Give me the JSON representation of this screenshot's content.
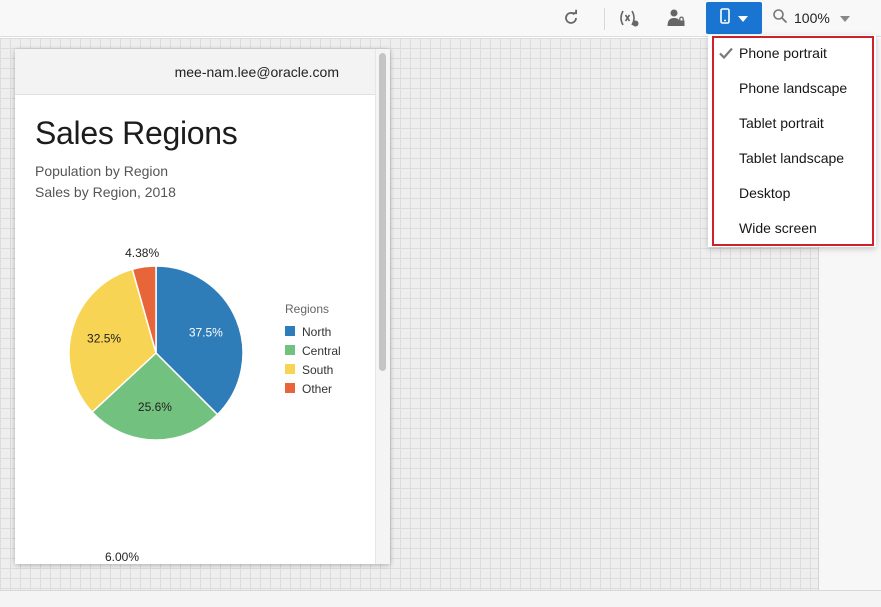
{
  "toolbar": {
    "refresh_icon": "refresh-icon",
    "variables_icon": "variables-icon",
    "person_icon": "person-lock-icon",
    "device_icon": "phone-icon",
    "device_caret_icon": "caret-down-icon",
    "zoom_icon": "magnifier-icon",
    "zoom_value": "100%",
    "zoom_caret_icon": "caret-down-icon",
    "accent_color": "#1a74d1"
  },
  "device_menu": {
    "highlight_color": "#d0202a",
    "items": [
      {
        "label": "Phone portrait",
        "checked": true
      },
      {
        "label": "Phone landscape",
        "checked": false
      },
      {
        "label": "Tablet portrait",
        "checked": false
      },
      {
        "label": "Tablet landscape",
        "checked": false
      },
      {
        "label": "Desktop",
        "checked": false
      },
      {
        "label": "Wide screen",
        "checked": false
      }
    ]
  },
  "phone": {
    "user_email": "mee-nam.lee@oracle.com",
    "page_title": "Sales Regions",
    "subtitle_1": "Population by Region",
    "subtitle_2": "Sales by Region, 2018"
  },
  "chart_data": [
    {
      "type": "pie",
      "title": "",
      "legend_title": "Regions",
      "legend_position": "right",
      "slices": [
        {
          "name": "North",
          "value": 37.5,
          "label": "37.5%",
          "color": "#2e7cb8"
        },
        {
          "name": "Central",
          "value": 25.6,
          "label": "25.6%",
          "color": "#72c17e"
        },
        {
          "name": "South",
          "value": 32.5,
          "label": "32.5%",
          "color": "#f8d455"
        },
        {
          "name": "Other",
          "value": 4.38,
          "label": "4.38%",
          "color": "#e8653a"
        }
      ]
    },
    {
      "type": "pie",
      "title": "",
      "visible_labels": [
        "6.00%"
      ]
    }
  ]
}
